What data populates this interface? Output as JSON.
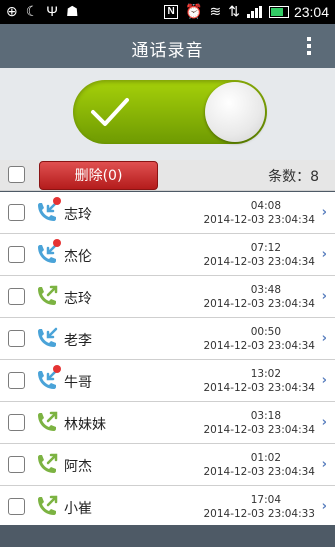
{
  "status": {
    "time": "23:04",
    "nfc": "N"
  },
  "header": {
    "title": "通话录音"
  },
  "toolbar": {
    "delete_label": "删除(0)",
    "count_label": "条数：8"
  },
  "colors": {
    "accent_green": "#8cbf08",
    "delete_red": "#c62828",
    "incoming_icon": "#4aa3d8",
    "outgoing_icon": "#7cb342",
    "badge_red": "#e53333"
  },
  "records": [
    {
      "name": "志玲",
      "duration": "04:08",
      "timestamp": "2014-12-03 23:04:34",
      "direction": "incoming",
      "unread": true
    },
    {
      "name": "杰伦",
      "duration": "07:12",
      "timestamp": "2014-12-03 23:04:34",
      "direction": "incoming",
      "unread": true
    },
    {
      "name": "志玲",
      "duration": "03:48",
      "timestamp": "2014-12-03 23:04:34",
      "direction": "outgoing",
      "unread": false
    },
    {
      "name": "老李",
      "duration": "00:50",
      "timestamp": "2014-12-03 23:04:34",
      "direction": "incoming",
      "unread": false
    },
    {
      "name": "牛哥",
      "duration": "13:02",
      "timestamp": "2014-12-03 23:04:34",
      "direction": "incoming",
      "unread": true
    },
    {
      "name": "林妹妹",
      "duration": "03:18",
      "timestamp": "2014-12-03 23:04:34",
      "direction": "outgoing",
      "unread": false
    },
    {
      "name": "阿杰",
      "duration": "01:02",
      "timestamp": "2014-12-03 23:04:34",
      "direction": "outgoing",
      "unread": false
    },
    {
      "name": "小崔",
      "duration": "17:04",
      "timestamp": "2014-12-03 23:04:33",
      "direction": "outgoing",
      "unread": false
    }
  ]
}
